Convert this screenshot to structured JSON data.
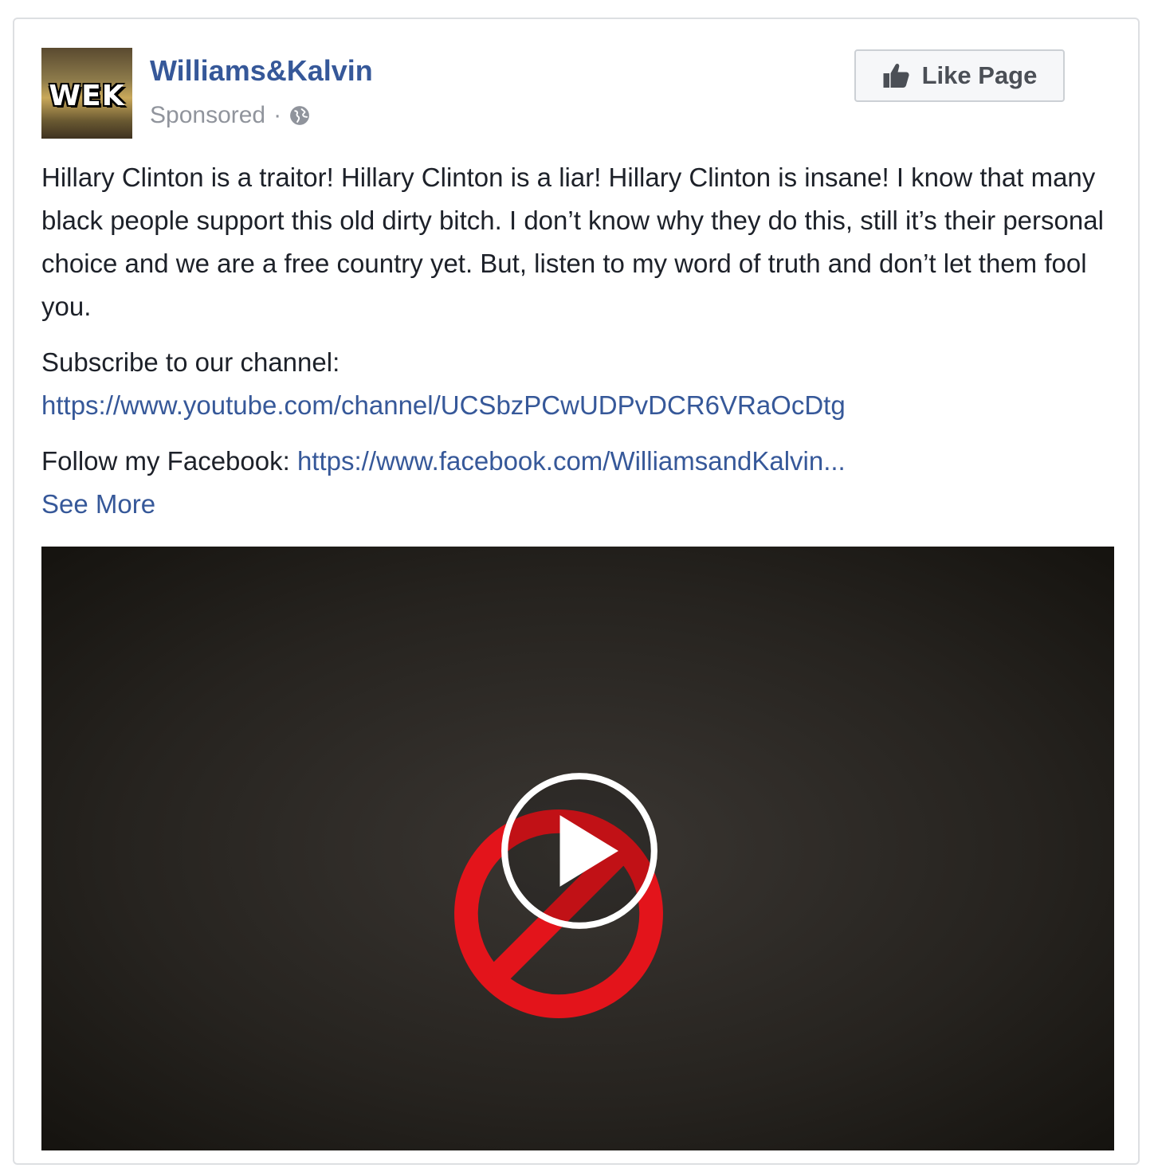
{
  "post": {
    "page_name": "Williams&Kalvin",
    "avatar_text": "WEK",
    "sponsored_label": "Sponsored",
    "separator": "·",
    "privacy_icon": "globe-icon",
    "like_button_label": "Like Page",
    "like_icon": "thumbs-up-icon",
    "paragraphs": {
      "main": "Hillary Clinton is a traitor! Hillary Clinton is a liar! Hillary Clinton is insane! I know that many black people support this old dirty bitch. I don’t know why they do this, still it’s their personal choice and we are a free country yet. But, listen to my word of truth and don’t let them fool you.",
      "subscribe_label": "Subscribe to our channel:",
      "youtube_link": "https://www.youtube.com/channel/UCSbzPCwUDPvDCR6VRaOcDtg",
      "follow_label": "Follow my Facebook: ",
      "facebook_link": "https://www.facebook.com/WilliamsandKalvin...",
      "see_more": "See More"
    },
    "video": {
      "overlay_icon": "prohibition-icon",
      "play_icon": "play-icon",
      "colors": {
        "ban_red": "#e3141b",
        "play_white": "#ffffff"
      }
    }
  },
  "colors": {
    "link": "#365899",
    "meta": "#90949c",
    "text": "#1d2129",
    "border": "#dddfe2"
  }
}
